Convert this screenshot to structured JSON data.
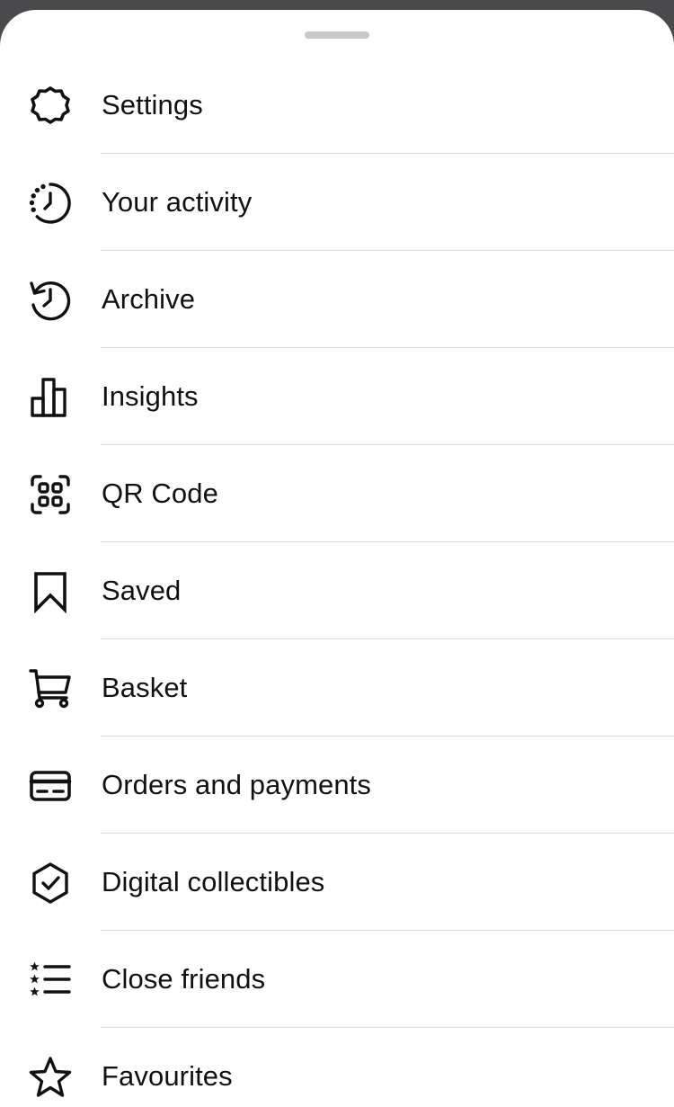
{
  "sheet": {
    "items": [
      {
        "label": "Settings",
        "icon": "gear-icon"
      },
      {
        "label": "Your activity",
        "icon": "activity-clock-icon"
      },
      {
        "label": "Archive",
        "icon": "archive-history-icon"
      },
      {
        "label": "Insights",
        "icon": "bar-chart-icon"
      },
      {
        "label": "QR Code",
        "icon": "qr-code-icon"
      },
      {
        "label": "Saved",
        "icon": "bookmark-icon"
      },
      {
        "label": "Basket",
        "icon": "shopping-cart-icon"
      },
      {
        "label": "Orders and payments",
        "icon": "credit-card-icon"
      },
      {
        "label": "Digital collectibles",
        "icon": "check-badge-icon"
      },
      {
        "label": "Close friends",
        "icon": "star-list-icon"
      },
      {
        "label": "Favourites",
        "icon": "star-icon"
      }
    ]
  },
  "colors": {
    "background_overlay": "#4a4a4c",
    "sheet": "#ffffff",
    "text": "#111111",
    "divider": "#dcdcde",
    "grabber": "#c9c9cc"
  }
}
